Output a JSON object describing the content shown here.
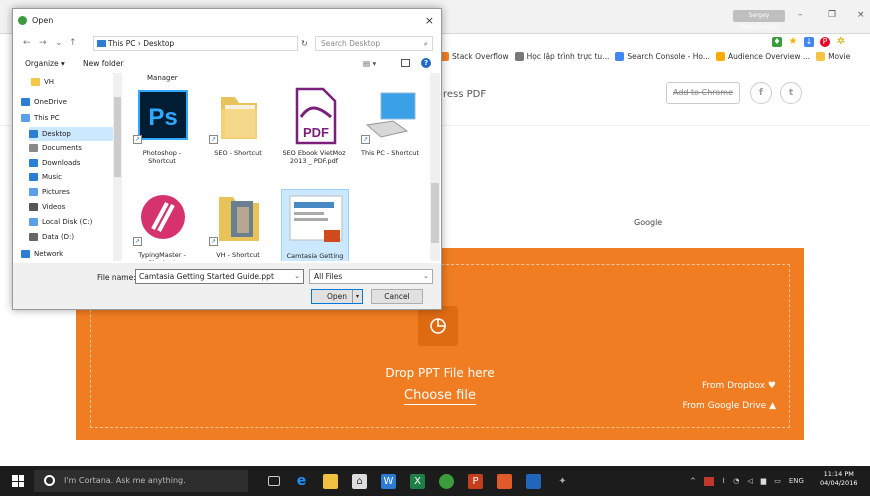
{
  "browser": {
    "profile_label": "Sergey Shevchenko",
    "window_controls": [
      "–",
      "❐",
      "×"
    ],
    "bookmarks": [
      {
        "label": "Stack Overflow",
        "color": "#f48024"
      },
      {
        "label": "Học lập trình trực tu...",
        "color": "#777777"
      },
      {
        "label": "Search Console - Ho...",
        "color": "#4285f4"
      },
      {
        "label": "Audience Overview ...",
        "color": "#f9ab00"
      },
      {
        "label": "Movie",
        "color": "#f6c344"
      }
    ]
  },
  "site": {
    "tagline": "ress PDF",
    "add_to_chrome": "Add to Chrome",
    "facebook_icon": "f",
    "twitter_icon": "t",
    "google_ad": "Google",
    "accent_color": "#f07d22",
    "drop_text": "Drop PPT File here",
    "choose_file": "Choose file",
    "from_dropbox": "From Dropbox",
    "from_gdrive": "From Google Drive"
  },
  "dialog": {
    "title": "Open",
    "close": "×",
    "address": "This PC  ›  Desktop",
    "search_placeholder": "Search Desktop",
    "organize": "Organize ▾",
    "new_folder": "New folder",
    "nav_items": [
      {
        "label": "VH",
        "color": "#f3c74a",
        "selected": false
      },
      {
        "label": "OneDrive",
        "color": "#2a7fd4",
        "selected": false
      },
      {
        "label": "This PC",
        "color": "#5aa0e8",
        "selected": false
      },
      {
        "label": "Desktop",
        "color": "#2a7fd4",
        "selected": true
      },
      {
        "label": "Documents",
        "color": "#888888",
        "selected": false
      },
      {
        "label": "Downloads",
        "color": "#2a7fd4",
        "selected": false
      },
      {
        "label": "Music",
        "color": "#2a7fd4",
        "selected": false
      },
      {
        "label": "Pictures",
        "color": "#5aa0e8",
        "selected": false
      },
      {
        "label": "Videos",
        "color": "#555555",
        "selected": false
      },
      {
        "label": "Local Disk (C:)",
        "color": "#5aa0e8",
        "selected": false
      },
      {
        "label": "Data (D:)",
        "color": "#666666",
        "selected": false
      },
      {
        "label": "Network",
        "color": "#2a7fd4",
        "selected": false
      }
    ],
    "top_label": "Manager",
    "files": [
      {
        "label": "Photoshop - Shortcut",
        "kind": "photoshop"
      },
      {
        "label": "SEO - Shortcut",
        "kind": "folder"
      },
      {
        "label": "SEO Ebook VietMoz 2013 _ PDF.pdf",
        "kind": "pdf"
      },
      {
        "label": "This PC - Shortcut",
        "kind": "pc"
      },
      {
        "label": "TypingMaster - Shortcut",
        "kind": "typing"
      },
      {
        "label": "VH - Shortcut",
        "kind": "folder-photo"
      },
      {
        "label": "Camtasia Getting Started Guide.ppt",
        "kind": "ppt"
      }
    ],
    "filename_label": "File name:",
    "filename_value": "Camtasia Getting Started Guide.ppt",
    "filetype_value": "All Files",
    "open_label": "Open",
    "cancel_label": "Cancel"
  },
  "taskbar": {
    "cortana_placeholder": "I'm Cortana. Ask me anything.",
    "lang": "ENG",
    "time": "11:14 PM",
    "date": "04/04/2016"
  }
}
